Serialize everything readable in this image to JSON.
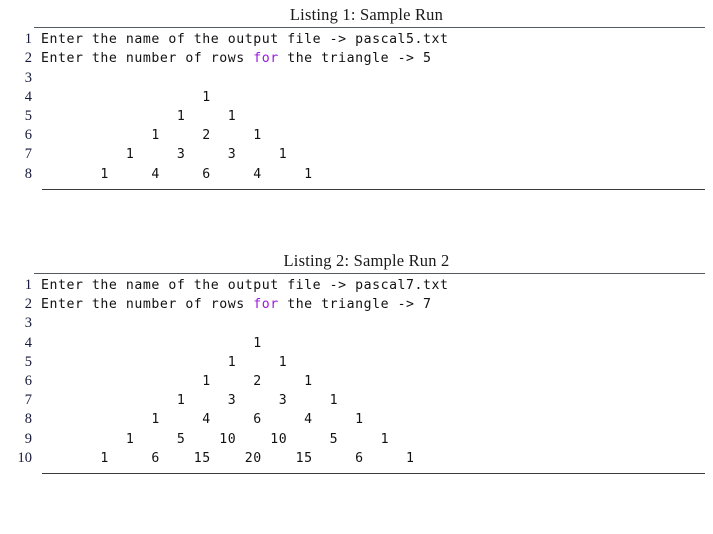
{
  "page": {
    "background_color": "#ffffff",
    "text_color": "#000000",
    "keyword_color": "#9b16e0",
    "rule_color": "#3a3a3a",
    "lineno_color": "#15193a"
  },
  "listings": [
    {
      "caption": "Listing 1: Sample Run",
      "lines": [
        {
          "no": "1",
          "type": "prompt",
          "pre": "Enter the name of the output file -> pascal5.txt",
          "keyword": "",
          "post": ""
        },
        {
          "no": "2",
          "type": "prompt-kw",
          "pre": "Enter the number of rows ",
          "keyword": "for",
          "post": " the triangle -> 5"
        },
        {
          "no": "3",
          "type": "blank",
          "text": ""
        },
        {
          "no": "4",
          "type": "triangle",
          "text": "                   1"
        },
        {
          "no": "5",
          "type": "triangle",
          "text": "                1     1"
        },
        {
          "no": "6",
          "type": "triangle",
          "text": "             1     2     1"
        },
        {
          "no": "7",
          "type": "triangle",
          "text": "          1     3     3     1"
        },
        {
          "no": "8",
          "type": "triangle",
          "text": "       1     4     6     4     1"
        }
      ]
    },
    {
      "caption": "Listing 2: Sample Run 2",
      "lines": [
        {
          "no": "1",
          "type": "prompt",
          "pre": "Enter the name of the output file -> pascal7.txt",
          "keyword": "",
          "post": ""
        },
        {
          "no": "2",
          "type": "prompt-kw",
          "pre": "Enter the number of rows ",
          "keyword": "for",
          "post": " the triangle -> 7"
        },
        {
          "no": "3",
          "type": "blank",
          "text": ""
        },
        {
          "no": "4",
          "type": "triangle",
          "text": "                         1"
        },
        {
          "no": "5",
          "type": "triangle",
          "text": "                      1     1"
        },
        {
          "no": "6",
          "type": "triangle",
          "text": "                   1     2     1"
        },
        {
          "no": "7",
          "type": "triangle",
          "text": "                1     3     3     1"
        },
        {
          "no": "8",
          "type": "triangle",
          "text": "             1     4     6     4     1"
        },
        {
          "no": "9",
          "type": "triangle",
          "text": "          1     5    10    10     5     1"
        },
        {
          "no": "10",
          "type": "triangle",
          "text": "       1     6    15    20    15     6     1"
        }
      ]
    }
  ],
  "chart_data": {
    "type": "table",
    "title": "Pascal's Triangle sample runs",
    "runs": [
      {
        "name": "Sample Run",
        "output_file": "pascal5.txt",
        "rows": 5,
        "triangle": [
          [
            1
          ],
          [
            1,
            1
          ],
          [
            1,
            2,
            1
          ],
          [
            1,
            3,
            3,
            1
          ],
          [
            1,
            4,
            6,
            4,
            1
          ]
        ]
      },
      {
        "name": "Sample Run 2",
        "output_file": "pascal7.txt",
        "rows": 7,
        "triangle": [
          [
            1
          ],
          [
            1,
            1
          ],
          [
            1,
            2,
            1
          ],
          [
            1,
            3,
            3,
            1
          ],
          [
            1,
            4,
            6,
            4,
            1
          ],
          [
            1,
            5,
            10,
            10,
            5,
            1
          ],
          [
            1,
            6,
            15,
            20,
            15,
            6,
            1
          ]
        ]
      }
    ]
  }
}
